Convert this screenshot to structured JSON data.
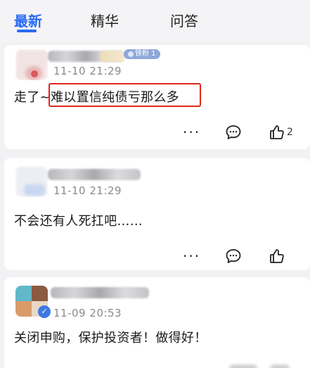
{
  "tabs": [
    {
      "label": "最新",
      "active": true
    },
    {
      "label": "精华",
      "active": false
    },
    {
      "label": "问答",
      "active": false
    }
  ],
  "posts": [
    {
      "time": "11-10 21:29",
      "badge": "铁粉 1",
      "content": "走了~难以置信纯债亏那么多",
      "highlighted_text": "难以置信纯债亏那么多",
      "more": "···",
      "likes": "2"
    },
    {
      "time": "11-10 21:29",
      "content": "不会还有人死扛吧……",
      "more": "···",
      "likes": ""
    },
    {
      "time": "11-09 20:53",
      "content": "关闭申购，保护投资者！做得好！"
    }
  ],
  "colors": {
    "accent": "#2a6bf2",
    "highlight_border": "#e0261e",
    "badge_bg": "#8fa7d8"
  },
  "icons": {
    "comment": "comment-bubble-icon",
    "like": "thumbs-up-icon",
    "more": "more-dots-icon"
  }
}
